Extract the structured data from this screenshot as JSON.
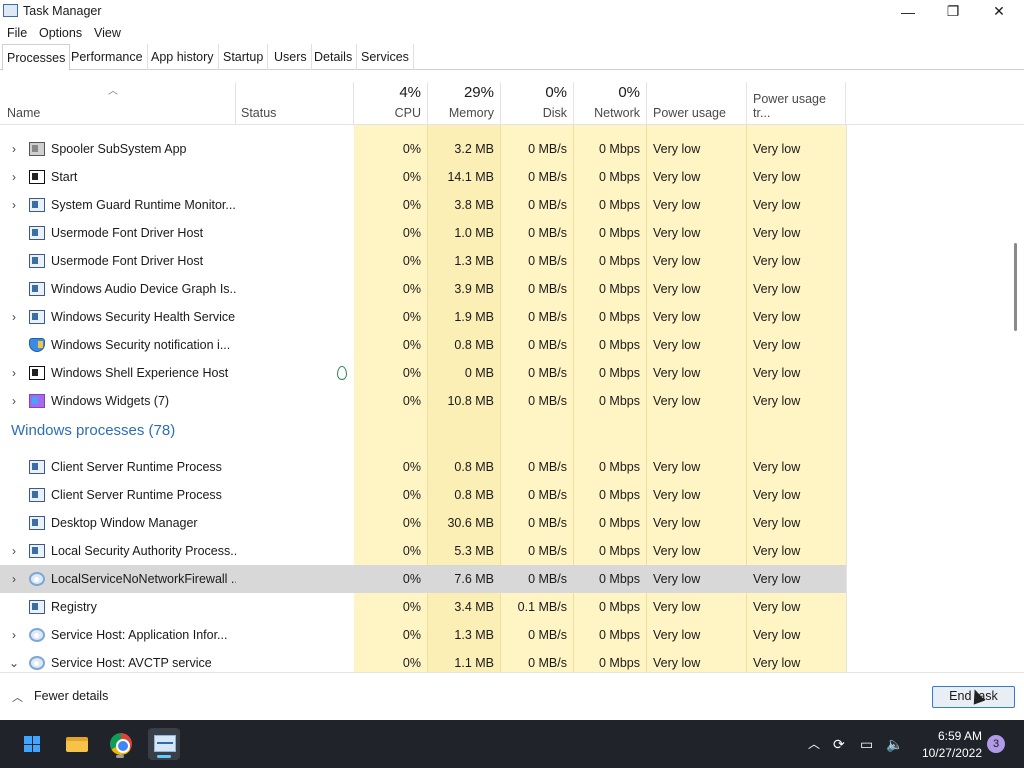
{
  "window": {
    "title": "Task Manager",
    "minimize_glyph": "—",
    "restore_glyph": "❐",
    "close_glyph": "✕"
  },
  "menu": [
    "File",
    "Options",
    "View"
  ],
  "tabs": [
    "Processes",
    "Performance",
    "App history",
    "Startup",
    "Users",
    "Details",
    "Services"
  ],
  "active_tab": "Processes",
  "columns": {
    "name": "Name",
    "status": "Status",
    "cpu": {
      "pct": "4%",
      "label": "CPU"
    },
    "memory": {
      "pct": "29%",
      "label": "Memory"
    },
    "disk": {
      "pct": "0%",
      "label": "Disk"
    },
    "network": {
      "pct": "0%",
      "label": "Network"
    },
    "power": "Power usage",
    "power_trend": "Power usage tr..."
  },
  "rows_top": [
    {
      "name": "Spooler SubSystem App",
      "icon": "printer-icon",
      "expand": "›",
      "cpu": "0%",
      "mem": "3.2 MB",
      "disk": "0 MB/s",
      "net": "0 Mbps",
      "pwr": "Very low",
      "pwrt": "Very low"
    },
    {
      "name": "Start",
      "icon": "start-icon",
      "expand": "›",
      "cpu": "0%",
      "mem": "14.1 MB",
      "disk": "0 MB/s",
      "net": "0 Mbps",
      "pwr": "Very low",
      "pwrt": "Very low"
    },
    {
      "name": "System Guard Runtime Monitor...",
      "icon": "app-window-icon",
      "expand": "›",
      "cpu": "0%",
      "mem": "3.8 MB",
      "disk": "0 MB/s",
      "net": "0 Mbps",
      "pwr": "Very low",
      "pwrt": "Very low"
    },
    {
      "name": "Usermode Font Driver Host",
      "icon": "app-window-icon",
      "expand": "",
      "cpu": "0%",
      "mem": "1.0 MB",
      "disk": "0 MB/s",
      "net": "0 Mbps",
      "pwr": "Very low",
      "pwrt": "Very low"
    },
    {
      "name": "Usermode Font Driver Host",
      "icon": "app-window-icon",
      "expand": "",
      "cpu": "0%",
      "mem": "1.3 MB",
      "disk": "0 MB/s",
      "net": "0 Mbps",
      "pwr": "Very low",
      "pwrt": "Very low"
    },
    {
      "name": "Windows Audio Device Graph Is...",
      "icon": "app-window-icon",
      "expand": "",
      "cpu": "0%",
      "mem": "3.9 MB",
      "disk": "0 MB/s",
      "net": "0 Mbps",
      "pwr": "Very low",
      "pwrt": "Very low"
    },
    {
      "name": "Windows Security Health Service",
      "icon": "app-window-icon",
      "expand": "›",
      "cpu": "0%",
      "mem": "1.9 MB",
      "disk": "0 MB/s",
      "net": "0 Mbps",
      "pwr": "Very low",
      "pwrt": "Very low"
    },
    {
      "name": "Windows Security notification i...",
      "icon": "shield-icon",
      "expand": "",
      "cpu": "0%",
      "mem": "0.8 MB",
      "disk": "0 MB/s",
      "net": "0 Mbps",
      "pwr": "Very low",
      "pwrt": "Very low"
    },
    {
      "name": "Windows Shell Experience Host",
      "icon": "start-icon",
      "expand": "›",
      "cpu": "0%",
      "mem": "0 MB",
      "disk": "0 MB/s",
      "net": "0 Mbps",
      "pwr": "Very low",
      "pwrt": "Very low"
    },
    {
      "name": "Windows Widgets (7)",
      "icon": "widgets-icon",
      "expand": "›",
      "cpu": "0%",
      "mem": "10.8 MB",
      "disk": "0 MB/s",
      "net": "0 Mbps",
      "pwr": "Very low",
      "pwrt": "Very low"
    }
  ],
  "group_title": "Windows processes (78)",
  "rows_bottom": [
    {
      "name": "Client Server Runtime Process",
      "icon": "app-window-icon",
      "expand": "",
      "cpu": "0%",
      "mem": "0.8 MB",
      "disk": "0 MB/s",
      "net": "0 Mbps",
      "pwr": "Very low",
      "pwrt": "Very low"
    },
    {
      "name": "Client Server Runtime Process",
      "icon": "app-window-icon",
      "expand": "",
      "cpu": "0%",
      "mem": "0.8 MB",
      "disk": "0 MB/s",
      "net": "0 Mbps",
      "pwr": "Very low",
      "pwrt": "Very low"
    },
    {
      "name": "Desktop Window Manager",
      "icon": "app-window-icon",
      "expand": "",
      "cpu": "0%",
      "mem": "30.6 MB",
      "disk": "0 MB/s",
      "net": "0 Mbps",
      "pwr": "Very low",
      "pwrt": "Very low"
    },
    {
      "name": "Local Security Authority Process...",
      "icon": "app-window-icon",
      "expand": "›",
      "cpu": "0%",
      "mem": "5.3 MB",
      "disk": "0 MB/s",
      "net": "0 Mbps",
      "pwr": "Very low",
      "pwrt": "Very low"
    },
    {
      "name": "LocalServiceNoNetworkFirewall ...",
      "icon": "gear-icon",
      "expand": "›",
      "cpu": "0%",
      "mem": "7.6 MB",
      "disk": "0 MB/s",
      "net": "0 Mbps",
      "pwr": "Very low",
      "pwrt": "Very low",
      "selected": true
    },
    {
      "name": "Registry",
      "icon": "app-window-icon",
      "expand": "",
      "cpu": "0%",
      "mem": "3.4 MB",
      "disk": "0.1 MB/s",
      "net": "0 Mbps",
      "pwr": "Very low",
      "pwrt": "Very low"
    },
    {
      "name": "Service Host: Application Infor...",
      "icon": "gear-icon",
      "expand": "›",
      "cpu": "0%",
      "mem": "1.3 MB",
      "disk": "0 MB/s",
      "net": "0 Mbps",
      "pwr": "Very low",
      "pwrt": "Very low"
    },
    {
      "name": "Service Host: AVCTP service",
      "icon": "gear-icon",
      "expand": "⌄",
      "cpu": "0%",
      "mem": "1.1 MB",
      "disk": "0 MB/s",
      "net": "0 Mbps",
      "pwr": "Very low",
      "pwrt": "Very low"
    }
  ],
  "footer": {
    "fewer_details": "Fewer details",
    "end_task": "End task"
  },
  "taskbar": {
    "time": "6:59 AM",
    "date": "10/27/2022",
    "notifications": "3"
  }
}
